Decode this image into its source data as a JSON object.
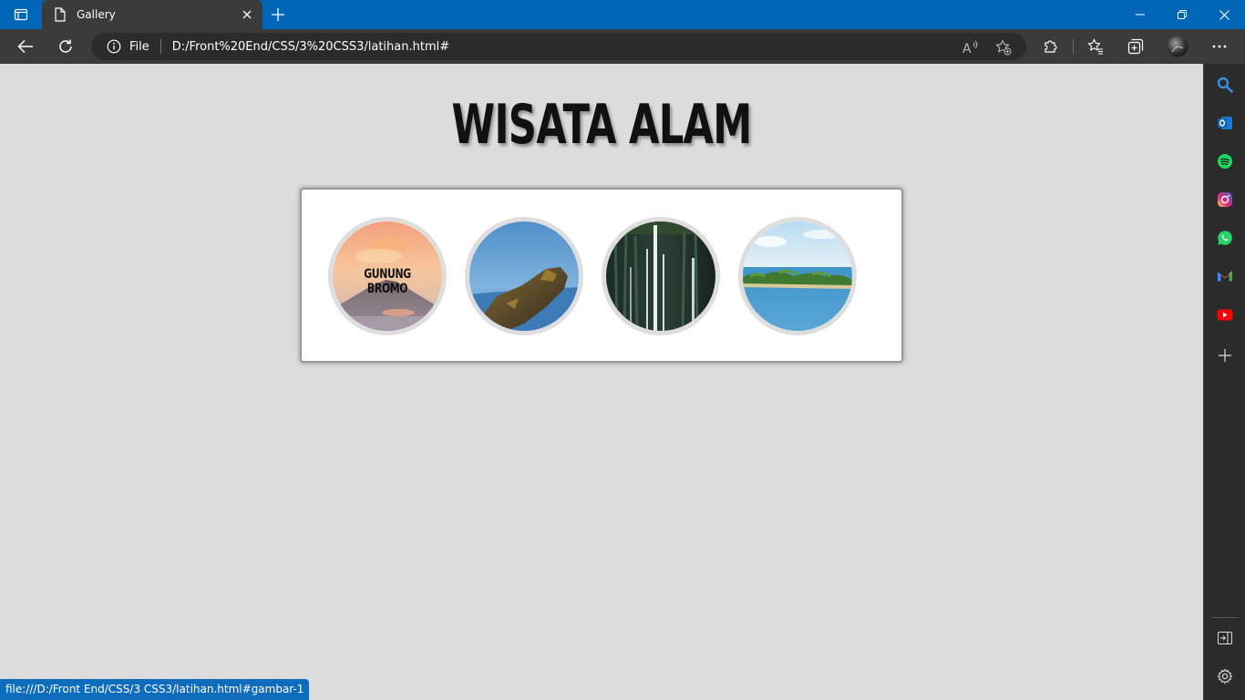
{
  "browser": {
    "tab_title": "Gallery",
    "address_scheme": "File",
    "address_url": "D:/Front%20End/CSS/3%20CSS3/latihan.html#",
    "status_text": "file:///D:/Front End/CSS/3 CSS3/latihan.html#gambar-1",
    "accent_color": "#0067b8"
  },
  "page": {
    "title": "WISATA ALAM",
    "gallery": [
      {
        "caption": "GUNUNG BROMO",
        "scene": "volcano"
      },
      {
        "caption": "",
        "scene": "rock-coast"
      },
      {
        "caption": "",
        "scene": "waterfall"
      },
      {
        "caption": "",
        "scene": "island-sea"
      }
    ]
  },
  "sidebar": {
    "icons": [
      "search-icon",
      "outlook-icon",
      "spotify-icon",
      "instagram-icon",
      "whatsapp-icon",
      "gmail-icon",
      "youtube-icon",
      "add-icon",
      "hide-sidebar-icon",
      "settings-icon"
    ]
  }
}
